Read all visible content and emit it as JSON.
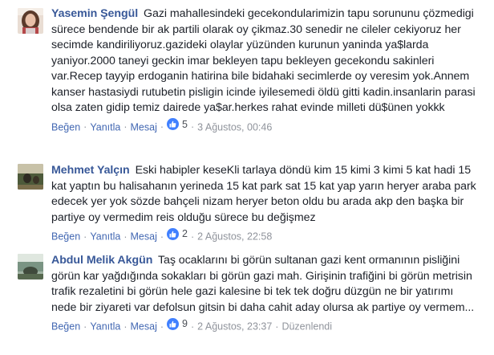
{
  "comments": [
    {
      "author": "Yasemin Şengül",
      "text": "Gazi mahallesindeki gecekondularimizin tapu sorununu çözmedigi sürece bendende bir ak partili olarak oy çikmaz.30 senedir ne cileler cekiyoruz her secimde kandiriliyoruz.gazideki olaylar yüzünden kurunun yaninda ya$larda yaniyor.2000 taneyi geckin imar bekleyen tapu bekleyen gecekondu sakinleri var.Recep tayyip erdoganin hatirina bile bidahaki secimlerde oy veresim yok.Annem kanser hastasiydi rutubetin pisligin icinde iyilesemedi öldü gitti kadin.insanlarin parasi olsa zaten gidip temiz dairede ya$ar.herkes rahat evinde milleti dü$ünen yokkk",
      "like_label": "Beğen",
      "reply_label": "Yanıtla",
      "message_label": "Mesaj",
      "like_count": "5",
      "timestamp": "3 Ağustos, 00:46"
    },
    {
      "author": "Mehmet Yalçın",
      "text": "Eski habipler keseKli tarlaya döndü kim 15 kimi 3 kimi 5 kat hadi 15 kat yaptın bu halisahanın yerineda 15 kat park sat 15 kat yap yarın heryer araba park edecek yer yok sözde bahçeli nizam heryer beton oldu bu arada akp den başka bir partiye oy vermedim reis olduğu sürece bu değişmez",
      "like_label": "Beğen",
      "reply_label": "Yanıtla",
      "message_label": "Mesaj",
      "like_count": "2",
      "timestamp": "2 Ağustos, 22:58"
    },
    {
      "author": "Abdul Melik Akgün",
      "text": "Taş ocaklarını bi görün sultanan gazi kent ormanının pisliğini görün kar yağdığında sokakları bi görün gazi mah. Girişinin trafiğini bi görün metrisin trafik rezaletini bi görün hele gazi kalesine bi tek tek doğru düzgün ne bir yatırımı nede bir ziyareti var defolsun gitsin bi daha cahit aday olursa ak partiye oy vermem...",
      "like_label": "Beğen",
      "reply_label": "Yanıtla",
      "message_label": "Mesaj",
      "like_count": "9",
      "timestamp": "2 Ağustos, 23:37",
      "edited_label": "Düzenlendi"
    }
  ],
  "icons": {
    "like": "thumbs-up-icon"
  },
  "colors": {
    "author": "#385898",
    "link": "#4267b2",
    "like_badge": "#4080ff",
    "meta": "#90949c"
  }
}
